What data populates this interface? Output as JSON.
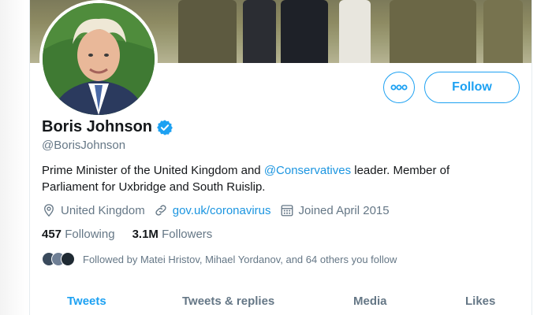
{
  "profile": {
    "name": "Boris Johnson",
    "handle": "@BorisJohnson",
    "bio_before": "Prime Minister of the United Kingdom and ",
    "bio_mention": "@Conservatives",
    "bio_after": " leader. Member of Parliament for Uxbridge and South Ruislip.",
    "location": "United Kingdom",
    "website": "gov.uk/coronavirus",
    "joined": "Joined April 2015"
  },
  "stats": {
    "following_count": "457",
    "following_label": "Following",
    "followers_count": "3.1M",
    "followers_label": "Followers"
  },
  "followed_by": "Followed by Matei Hristov, Mihael Yordanov, and 64 others you follow",
  "actions": {
    "follow_label": "Follow",
    "more_icon": "more-horizontal-icon"
  },
  "tabs": [
    {
      "label": "Tweets",
      "active": true
    },
    {
      "label": "Tweets & replies",
      "active": false
    },
    {
      "label": "Media",
      "active": false
    },
    {
      "label": "Likes",
      "active": false
    }
  ],
  "icons": {
    "verified": "verified-badge-icon",
    "location": "location-pin-icon",
    "link": "link-icon",
    "calendar": "calendar-icon"
  },
  "colors": {
    "accent": "#1da1f2",
    "link": "#1b95e0",
    "muted": "#657786",
    "text": "#14171a"
  }
}
